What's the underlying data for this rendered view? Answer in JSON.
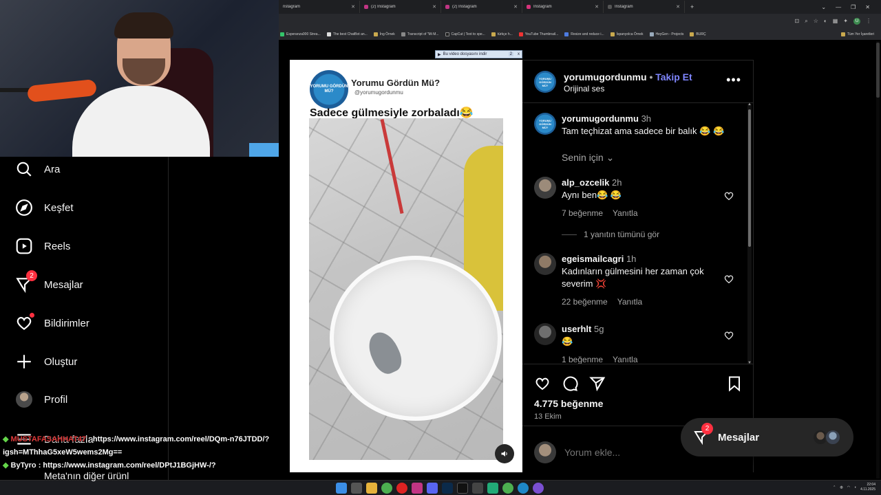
{
  "browser": {
    "tabs": [
      {
        "label": "nstagram"
      },
      {
        "label": "(2) Instagram"
      },
      {
        "label": "(2) Instagram"
      },
      {
        "label": "Instagram"
      },
      {
        "label": "Instagram"
      }
    ],
    "new_tab": "+",
    "bookmarks": [
      "Esperanza000 Strea...",
      "The best ChatBot an...",
      "İng Örnek",
      "Transcript of \"Mi M...",
      "CapCut | Text to spe...",
      "türkçe h...",
      "YouTube Thumbnail...",
      "Resize and reduce i...",
      "İspanyolca Örnek",
      "HeyGen - Projects",
      "BURÇ"
    ],
    "bookmarks_all": "Tüm Yer İşaretleri",
    "profile_initial": "U"
  },
  "download_bar": {
    "label": "Bu video dosyasını indir",
    "count": "2",
    "close": "x"
  },
  "nav": {
    "items": [
      {
        "label": "Ara",
        "icon": "search-icon"
      },
      {
        "label": "Keşfet",
        "icon": "compass-icon"
      },
      {
        "label": "Reels",
        "icon": "reels-icon"
      },
      {
        "label": "Mesajlar",
        "icon": "messenger-icon",
        "badge": "2"
      },
      {
        "label": "Bildirimler",
        "icon": "heart-icon"
      },
      {
        "label": "Oluştur",
        "icon": "plus-icon"
      },
      {
        "label": "Profil",
        "icon": "avatar"
      }
    ],
    "more_label": "Daha fazla",
    "meta_label": "Meta'nın diğer ürünl"
  },
  "chat": [
    {
      "user": "MUSTAFASAHHAT47",
      "text": ": https://www.instagram.com/reel/DQm-n76JTDD/?"
    },
    {
      "user": "",
      "text": "igsh=MThhaG5xeW5wems2Mg=="
    },
    {
      "user": "ByTyro",
      "text": ": https://www.instagram.com/reel/DPtJ1BGjHW-/?"
    }
  ],
  "video": {
    "logo_text": "YORUMU GÖRDÜN MÜ?",
    "channel_name": "Yorumu Gördün Mü?",
    "handle": "@yorumugordunmu",
    "caption": "Sadece gülmesiyle zorbaladı😂"
  },
  "post": {
    "username": "yorumugordunmu",
    "follow": "Takip Et",
    "separator": "•",
    "audio": "Orijinal ses",
    "author_comment": {
      "user": "yorumugordunmu",
      "time": "3h",
      "text": "Tam teçhizat ama sadece bir balık 😂 😂"
    },
    "sort": "Senin için",
    "comments": [
      {
        "user": "alp_ozcelik",
        "time": "2h",
        "text": "Aynı ben😂 😂",
        "likes": "7 beğenme",
        "reply": "Yanıtla"
      },
      {
        "user": "egeismailcagri",
        "time": "1h",
        "text": "Kadınların gülmesini her zaman çok severim 💢",
        "likes": "22 beğenme",
        "reply": "Yanıtla"
      },
      {
        "user": "userhlt",
        "time": "5g",
        "text": "😂",
        "likes": "1 beğenme",
        "reply": "Yanıtla"
      }
    ],
    "view_replies": "1 yanıtın tümünü gör",
    "like_count": "4.775 beğenme",
    "date": "13 Ekim",
    "add_comment_placeholder": "Yorum ekle..."
  },
  "messages_float": {
    "label": "Mesajlar",
    "badge": "2"
  },
  "taskbar": {
    "time": "22:04",
    "date": "4.11.2025"
  }
}
